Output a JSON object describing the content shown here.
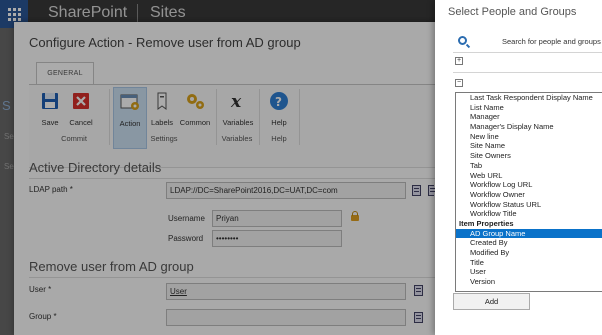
{
  "background": {
    "brand": "SharePoint",
    "section": "Sites",
    "left_glyph": "S",
    "left_texts": [
      "Se",
      "Se"
    ]
  },
  "dialog": {
    "title": "Configure Action - Remove user from AD group",
    "ribbon": {
      "tab": "GENERAL",
      "buttons": [
        {
          "label": "Save",
          "icon": "save-icon"
        },
        {
          "label": "Cancel",
          "icon": "cancel-icon"
        },
        {
          "label": "Action",
          "icon": "action-icon"
        },
        {
          "label": "Labels",
          "icon": "labels-icon"
        },
        {
          "label": "Common",
          "icon": "common-icon"
        },
        {
          "label": "Variables",
          "icon": "variables-icon"
        },
        {
          "label": "Help",
          "icon": "help-icon"
        }
      ],
      "groups": [
        "Commit",
        "Settings",
        "Variables",
        "Help"
      ]
    },
    "ad_section": {
      "title": "Active Directory details",
      "ldap_label": "LDAP path *",
      "ldap_value": "LDAP://DC=SharePoint2016,DC=UAT,DC=com",
      "username_label": "Username",
      "username_value": "Priyan",
      "password_label": "Password",
      "password_value": "••••••••"
    },
    "remove_section": {
      "title": "Remove user from AD group",
      "user_label": "User *",
      "user_value": "User",
      "group_label": "Group *",
      "group_value": ""
    }
  },
  "panel": {
    "title": "Select People and Groups",
    "search_text": "Search for people and groups",
    "expander_collapsed": "+",
    "expander_expanded": "−",
    "items": [
      {
        "label": "Last Task Respondent Display Name",
        "type": "item"
      },
      {
        "label": "List Name",
        "type": "item"
      },
      {
        "label": "Manager",
        "type": "item"
      },
      {
        "label": "Manager's Display Name",
        "type": "item"
      },
      {
        "label": "New line",
        "type": "item"
      },
      {
        "label": "Site Name",
        "type": "item"
      },
      {
        "label": "Site Owners",
        "type": "item"
      },
      {
        "label": "Tab",
        "type": "item"
      },
      {
        "label": "Web URL",
        "type": "item"
      },
      {
        "label": "Workflow Log URL",
        "type": "item"
      },
      {
        "label": "Workflow Owner",
        "type": "item"
      },
      {
        "label": "Workflow Status URL",
        "type": "item"
      },
      {
        "label": "Workflow Title",
        "type": "item"
      },
      {
        "label": "Item Properties",
        "type": "group"
      },
      {
        "label": "AD Group Name",
        "type": "selected"
      },
      {
        "label": "Created By",
        "type": "item"
      },
      {
        "label": "Modified By",
        "type": "item"
      },
      {
        "label": "Title",
        "type": "item"
      },
      {
        "label": "User",
        "type": "item"
      },
      {
        "label": "Version",
        "type": "item"
      }
    ],
    "add_label": "Add"
  },
  "colors": {
    "accent": "#0a72c9",
    "save": "#1f5fb3",
    "cancel": "#d9302c",
    "help": "#2f7fd4",
    "settings": "#d9a21c"
  }
}
